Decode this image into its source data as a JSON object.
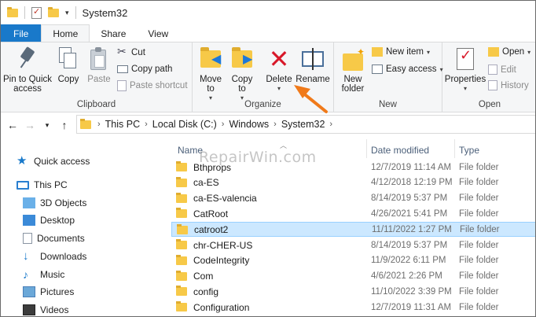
{
  "window": {
    "title": "System32"
  },
  "tabs": [
    {
      "label": "File"
    },
    {
      "label": "Home"
    },
    {
      "label": "Share"
    },
    {
      "label": "View"
    }
  ],
  "ribbon": {
    "clipboard": {
      "label": "Clipboard",
      "pin": "Pin to Quick access",
      "copy": "Copy",
      "paste": "Paste",
      "cut": "Cut",
      "copy_path": "Copy path",
      "paste_shortcut": "Paste shortcut"
    },
    "organize": {
      "label": "Organize",
      "move_to": "Move to",
      "copy_to": "Copy to",
      "delete": "Delete",
      "rename": "Rename"
    },
    "new": {
      "label": "New",
      "new_folder": "New folder",
      "new_item": "New item",
      "easy_access": "Easy access"
    },
    "open": {
      "label": "Open",
      "properties": "Properties",
      "open": "Open",
      "edit": "Edit",
      "history": "History"
    }
  },
  "address": {
    "crumbs": [
      "This PC",
      "Local Disk (C:)",
      "Windows",
      "System32"
    ]
  },
  "navpane": {
    "items": [
      {
        "label": "Quick access",
        "icon": "star-icon"
      },
      {
        "label": "This PC",
        "icon": "computer-icon"
      },
      {
        "label": "3D Objects",
        "icon": "cube-icon"
      },
      {
        "label": "Desktop",
        "icon": "desktop-icon"
      },
      {
        "label": "Documents",
        "icon": "document-icon"
      },
      {
        "label": "Downloads",
        "icon": "download-icon"
      },
      {
        "label": "Music",
        "icon": "music-icon"
      },
      {
        "label": "Pictures",
        "icon": "picture-icon"
      },
      {
        "label": "Videos",
        "icon": "video-icon"
      }
    ]
  },
  "columns": {
    "name": "Name",
    "date": "Date modified",
    "type": "Type"
  },
  "rows": [
    {
      "name": "Bthprops",
      "date": "12/7/2019 11:14 AM",
      "type": "File folder"
    },
    {
      "name": "ca-ES",
      "date": "4/12/2018 12:19 PM",
      "type": "File folder"
    },
    {
      "name": "ca-ES-valencia",
      "date": "8/14/2019 5:37 PM",
      "type": "File folder"
    },
    {
      "name": "CatRoot",
      "date": "4/26/2021 5:41 PM",
      "type": "File folder"
    },
    {
      "name": "catroot2",
      "date": "11/11/2022 1:27 PM",
      "type": "File folder",
      "selected": true
    },
    {
      "name": "chr-CHER-US",
      "date": "8/14/2019 5:37 PM",
      "type": "File folder"
    },
    {
      "name": "CodeIntegrity",
      "date": "11/9/2022 6:11 PM",
      "type": "File folder"
    },
    {
      "name": "Com",
      "date": "4/6/2021 2:26 PM",
      "type": "File folder"
    },
    {
      "name": "config",
      "date": "11/10/2022 3:39 PM",
      "type": "File folder"
    },
    {
      "name": "Configuration",
      "date": "12/7/2019 11:31 AM",
      "type": "File folder"
    }
  ],
  "watermark": "RepairWin.com",
  "colors": {
    "accent": "#1979ca",
    "selection": "#cce8ff",
    "annotation_arrow": "#f07a1a",
    "delete_icon": "#d8192a"
  }
}
